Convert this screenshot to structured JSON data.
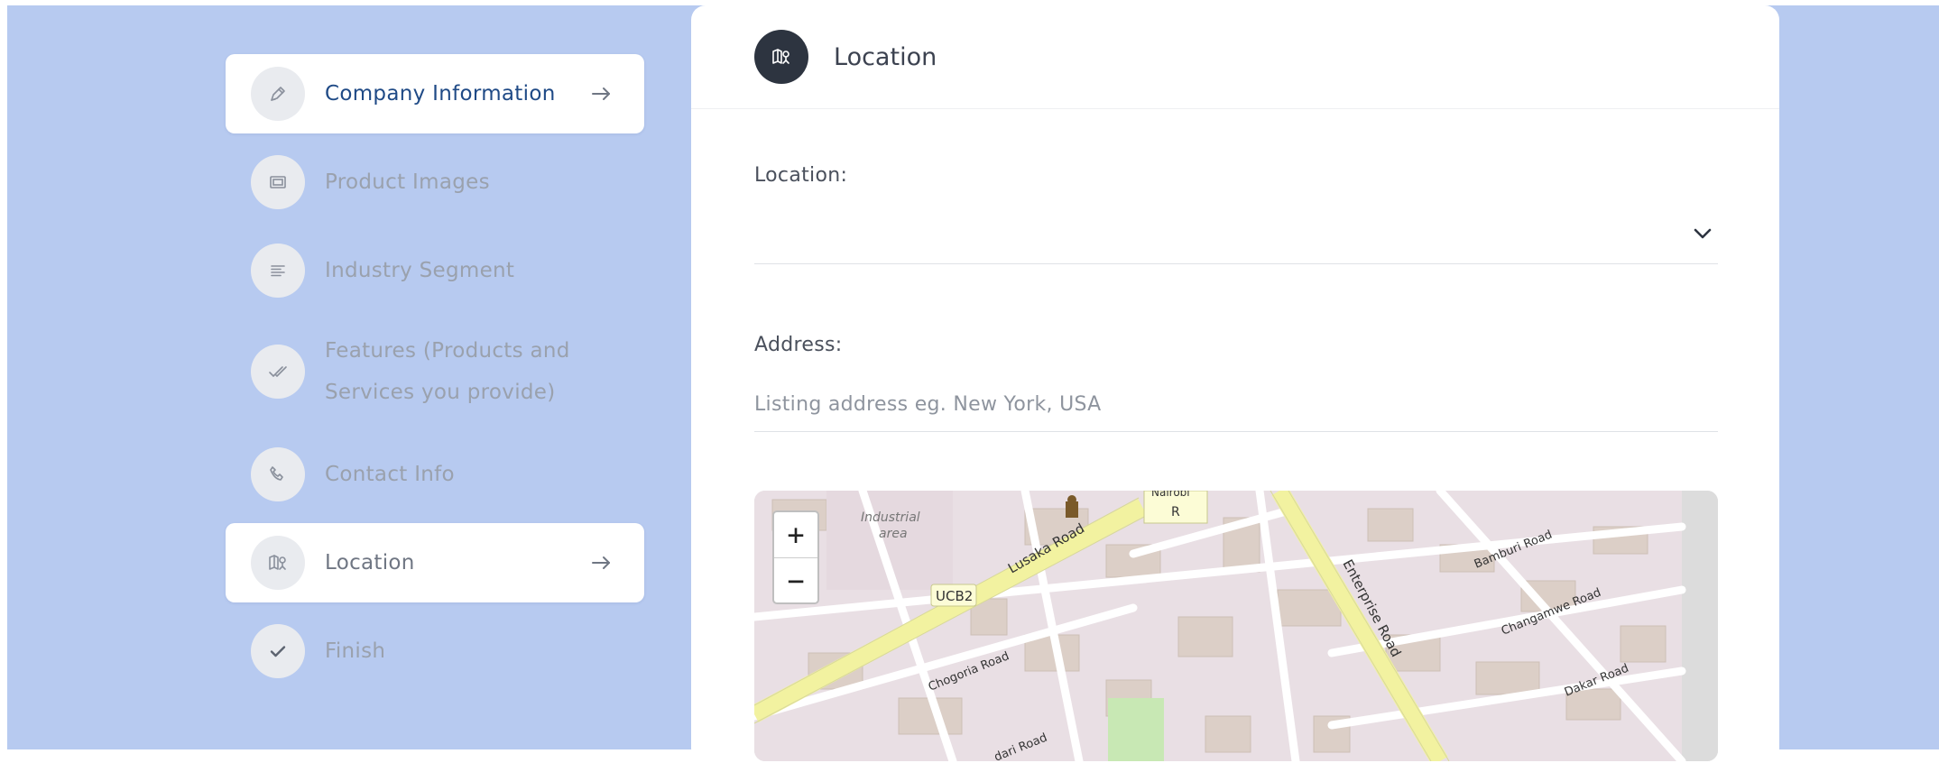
{
  "steps": [
    {
      "label": "Company Information",
      "icon": "pen-icon",
      "active": true
    },
    {
      "label": "Product Images",
      "icon": "image-icon",
      "active": false
    },
    {
      "label": "Industry Segment",
      "icon": "list-icon",
      "active": false
    },
    {
      "label_line1": "Features (Products and",
      "label_line2": "Services you provide)",
      "icon": "checks-icon",
      "active": false
    },
    {
      "label": "Contact Info",
      "icon": "phone-icon",
      "active": false
    },
    {
      "label": "Location",
      "icon": "map-icon",
      "active": true
    },
    {
      "label": "Finish",
      "icon": "check-icon",
      "active": false
    }
  ],
  "card": {
    "title": "Location",
    "location_label": "Location:",
    "location_value": "",
    "address_label": "Address:",
    "address_placeholder": "Listing address eg. New York, USA",
    "address_value": ""
  },
  "map": {
    "zoom_in": "+",
    "zoom_out": "−",
    "labels": {
      "industrial": "Industrial",
      "area": "area",
      "lusaka": "Lusaka Road",
      "ucb2": "UCB2",
      "nairobi": "Nairobi",
      "nairobi_r": "R",
      "enterprise": "Enterprise Road",
      "bamburi": "Bamburi Road",
      "changamwe": "Changamwe Road",
      "dakar": "Dakar Road",
      "chogoria": "Chogoria Road",
      "bottom": "dari Road"
    }
  },
  "colors": {
    "background": "#b7caf0",
    "accent_text": "#1f4a86",
    "header_icon_bg": "#2d3440"
  }
}
